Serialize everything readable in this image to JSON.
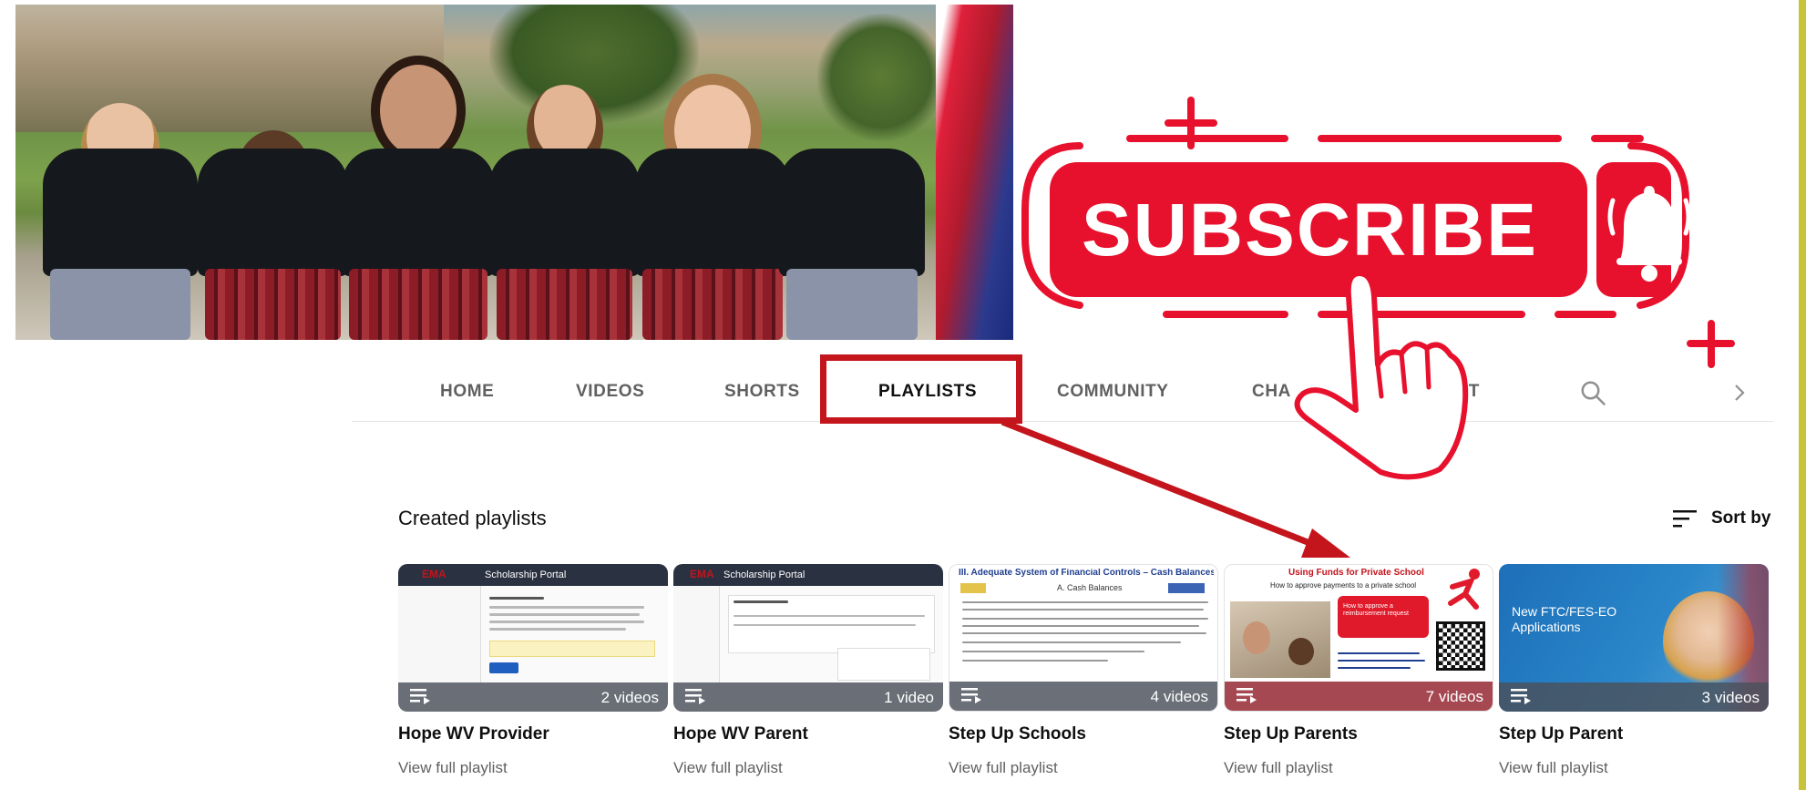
{
  "tabs": [
    {
      "label": "HOME"
    },
    {
      "label": "VIDEOS"
    },
    {
      "label": "SHORTS"
    },
    {
      "label": "PLAYLISTS"
    },
    {
      "label": "COMMUNITY"
    },
    {
      "label": "CHA"
    },
    {
      "label": "OUT"
    }
  ],
  "subscribe": {
    "label": "SUBSCRIBE"
  },
  "section": {
    "title": "Created playlists",
    "sort_label": "Sort by"
  },
  "playlists": [
    {
      "title": "Hope WV Provider",
      "count": "2 videos",
      "link": "View full playlist",
      "thumb_heading": "Scholarship Portal",
      "thumb_logo": "EMA"
    },
    {
      "title": "Hope WV Parent",
      "count": "1 video",
      "link": "View full playlist",
      "thumb_heading": "Scholarship Portal",
      "thumb_logo": "EMA"
    },
    {
      "title": "Step Up Schools",
      "count": "4 videos",
      "link": "View full playlist",
      "thumb_heading": "III. Adequate System of Financial Controls – Cash Balances",
      "thumb_sub": "A. Cash Balances"
    },
    {
      "title": "Step Up Parents",
      "count": "7 videos",
      "link": "View full playlist",
      "thumb_heading": "Using Funds for Private School",
      "thumb_sub": "How to approve payments to a private school",
      "thumb_callout": "How to approve a reimbursement request"
    },
    {
      "title": "Step Up Parent",
      "count": "3 videos",
      "link": "View full playlist",
      "thumb_heading": "New FTC/FES-EO Applications"
    }
  ],
  "colors": {
    "accent": "#c4141c",
    "subscribe_red": "#e8112d",
    "tab_active": "#0f0f0f",
    "tab_inactive": "#606060"
  },
  "icons": [
    "search-icon",
    "chevron-right-icon",
    "sort-icon",
    "playlist-icon",
    "bell-icon",
    "pointer-hand-icon"
  ]
}
